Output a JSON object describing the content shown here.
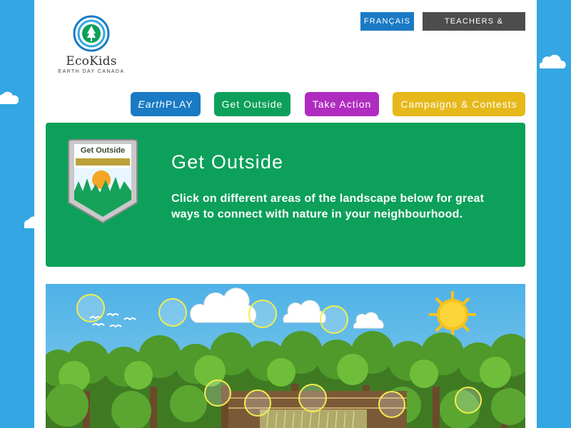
{
  "logo": {
    "name": "EcoKids",
    "subtitle": "EARTH DAY CANADA"
  },
  "utility_nav": {
    "language": "FRANÇAIS",
    "teachers_parents": "TEACHERS & PARENTS"
  },
  "main_nav": {
    "earthplay_italic": "Earth",
    "earthplay_rest": "PLAY",
    "get_outside": "Get Outside",
    "take_action": "Take Action",
    "campaigns": "Campaigns & Contests"
  },
  "badge": {
    "label": "Get Outside"
  },
  "banner": {
    "title": "Get Outside",
    "description": "Click on different areas of the landscape below for great ways to connect with nature in your neighbourhood."
  },
  "colors": {
    "page_bg": "#33a6e3",
    "blue": "#1a7ac4",
    "green": "#0ca05a",
    "purple": "#b02bc0",
    "yellow": "#e6b81a",
    "dark_gray": "#4d4d4d",
    "hotspot_ring": "#f2ee4e"
  }
}
